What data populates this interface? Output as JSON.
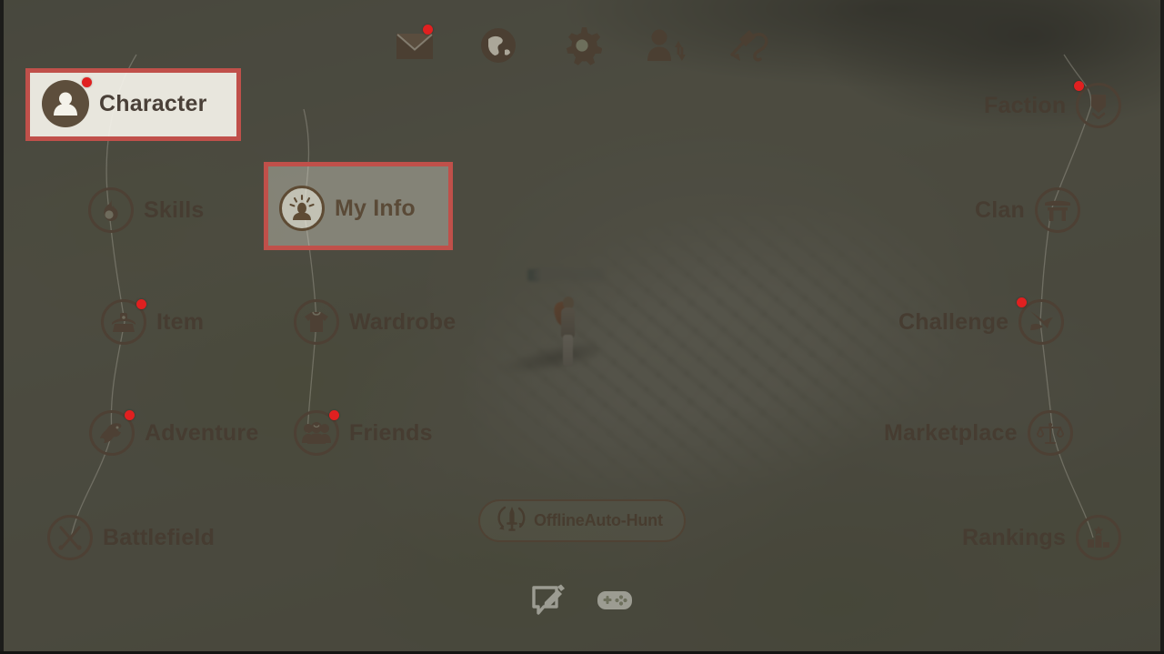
{
  "app": {
    "screen_name": "Main Menu Overlay",
    "accent_highlight_color": "#c0504a",
    "badge_color": "#e02020",
    "icon_color": "#4d4034",
    "overlay_color": "#3a3932"
  },
  "topbar": {
    "items": [
      {
        "name": "mail-icon",
        "label": "Mail",
        "badge": true
      },
      {
        "name": "world-icon",
        "label": "World",
        "badge": false
      },
      {
        "name": "settings-gear-icon",
        "label": "Settings",
        "badge": false
      },
      {
        "name": "switch-character-icon",
        "label": "Switch Character",
        "badge": false
      },
      {
        "name": "disconnect-plug-icon",
        "label": "Disconnect",
        "badge": false
      }
    ]
  },
  "menu": {
    "left_column": [
      {
        "id": "character",
        "label": "Character",
        "icon": "avatar-icon",
        "badge": true,
        "highlighted": true
      },
      {
        "id": "skills",
        "label": "Skills",
        "icon": "flame-icon",
        "badge": false,
        "highlighted": false
      },
      {
        "id": "item",
        "label": "Item",
        "icon": "bag-icon",
        "badge": true,
        "highlighted": false
      },
      {
        "id": "adventure",
        "label": "Adventure",
        "icon": "griffin-icon",
        "badge": true,
        "highlighted": false
      },
      {
        "id": "battlefield",
        "label": "Battlefield",
        "icon": "crossed-swords-icon",
        "badge": false,
        "highlighted": false
      }
    ],
    "middle_column": [
      {
        "id": "myinfo",
        "label": "My Info",
        "icon": "profile-spotlight-icon",
        "badge": false,
        "highlighted": true
      },
      {
        "id": "wardrobe",
        "label": "Wardrobe",
        "icon": "shirt-icon",
        "badge": false,
        "highlighted": false
      },
      {
        "id": "friends",
        "label": "Friends",
        "icon": "people-icon",
        "badge": true,
        "highlighted": false
      }
    ],
    "right_column": [
      {
        "id": "faction",
        "label": "Faction",
        "icon": "banner-icon",
        "badge": true,
        "highlighted": false
      },
      {
        "id": "clan",
        "label": "Clan",
        "icon": "gate-icon",
        "badge": false,
        "highlighted": false
      },
      {
        "id": "challenge",
        "label": "Challenge",
        "icon": "strike-icon",
        "badge": true,
        "highlighted": false
      },
      {
        "id": "marketplace",
        "label": "Marketplace",
        "icon": "scales-icon",
        "badge": false,
        "highlighted": false
      },
      {
        "id": "rankings",
        "label": "Rankings",
        "icon": "bar-chart-star-icon",
        "badge": false,
        "highlighted": false
      }
    ]
  },
  "auto_hunt": {
    "label": "OfflineAuto-Hunt",
    "icon": "sword-refresh-icon"
  },
  "bottombar": {
    "items": [
      {
        "name": "chat-compose-icon",
        "label": "Chat"
      },
      {
        "name": "gamepad-icon",
        "label": "Controller"
      }
    ]
  },
  "world": {
    "player_name_masked": true
  }
}
